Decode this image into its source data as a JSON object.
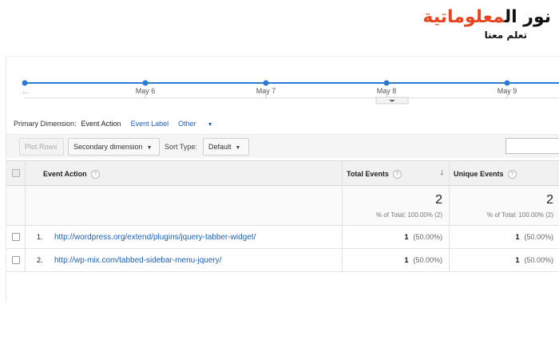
{
  "logo": {
    "main_dark": "نور ال",
    "main_accent": "معلوماتية",
    "tagline": "تعلم معنا"
  },
  "timeline": {
    "leading": "...",
    "dates": [
      "May 6",
      "May 7",
      "May 8",
      "May 9"
    ]
  },
  "dimension": {
    "label": "Primary Dimension:",
    "active": "Event Action",
    "options": [
      "Event Label",
      "Other"
    ]
  },
  "toolbar": {
    "plot_rows": "Plot Rows",
    "secondary_dimension": "Secondary dimension",
    "sort_type_label": "Sort Type:",
    "sort_type_value": "Default"
  },
  "table": {
    "headers": {
      "action": "Event Action",
      "total": "Total Events",
      "unique": "Unique Events",
      "help": "?"
    },
    "summary": {
      "total": "2",
      "total_pct": "% of Total: 100.00% (2)",
      "unique": "2",
      "unique_pct": "% of Total: 100.00% (2)"
    },
    "rows": [
      {
        "index": "1.",
        "action": "http://wordpress.org/extend/plugins/jquery-tabber-widget/",
        "total": "1",
        "total_pct": "(50.00%)",
        "unique": "1",
        "unique_pct": "(50.00%)"
      },
      {
        "index": "2.",
        "action": "http://wp-mix.com/tabbed-sidebar-menu-jquery/",
        "total": "1",
        "total_pct": "(50.00%)",
        "unique": "1",
        "unique_pct": "(50.00%)"
      }
    ]
  },
  "colors": {
    "accent": "#1a73e8",
    "link": "#1a5fb4",
    "logo_accent": "#e8431d"
  }
}
